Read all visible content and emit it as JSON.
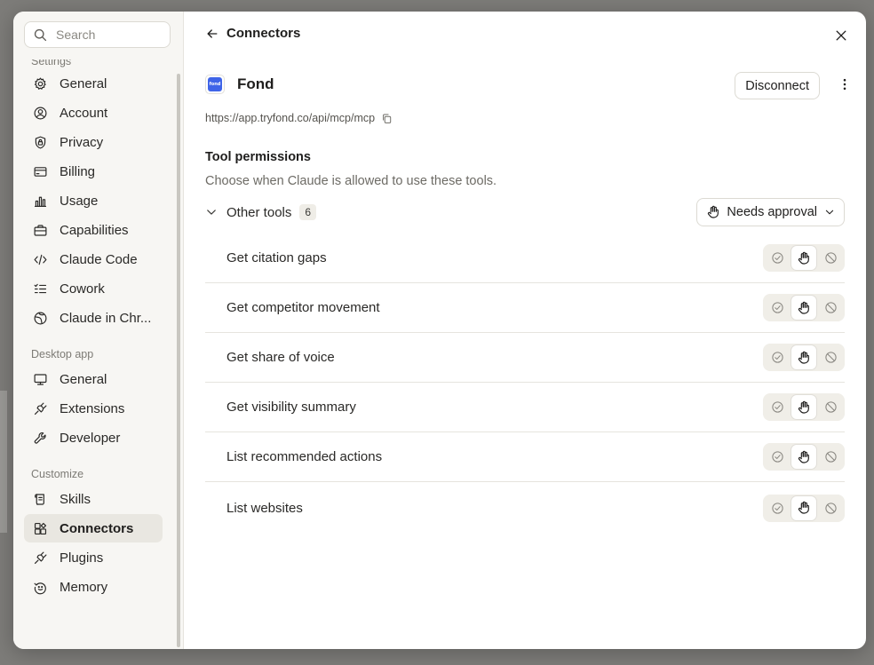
{
  "search": {
    "placeholder": "Search"
  },
  "sidebar": {
    "sections": [
      {
        "label": "Settings",
        "items": [
          {
            "label": "General",
            "icon": "gear-icon"
          },
          {
            "label": "Account",
            "icon": "user-circle-icon"
          },
          {
            "label": "Privacy",
            "icon": "shield-lock-icon"
          },
          {
            "label": "Billing",
            "icon": "credit-card-icon"
          },
          {
            "label": "Usage",
            "icon": "bar-chart-icon"
          },
          {
            "label": "Capabilities",
            "icon": "briefcase-icon"
          },
          {
            "label": "Claude Code",
            "icon": "code-icon"
          },
          {
            "label": "Cowork",
            "icon": "checklist-icon"
          },
          {
            "label": "Claude in Chr...",
            "icon": "globe-icon"
          }
        ]
      },
      {
        "label": "Desktop app",
        "items": [
          {
            "label": "General",
            "icon": "monitor-icon"
          },
          {
            "label": "Extensions",
            "icon": "plug-icon"
          },
          {
            "label": "Developer",
            "icon": "wrench-icon"
          }
        ]
      },
      {
        "label": "Customize",
        "items": [
          {
            "label": "Skills",
            "icon": "scroll-icon"
          },
          {
            "label": "Connectors",
            "icon": "connectors-icon",
            "active": true
          },
          {
            "label": "Plugins",
            "icon": "plug-icon"
          },
          {
            "label": "Memory",
            "icon": "memory-icon"
          }
        ]
      }
    ]
  },
  "header": {
    "title": "Connectors"
  },
  "connector": {
    "name": "Fond",
    "logo_text": "fond",
    "url": "https://app.tryfond.co/api/mcp/mcp",
    "disconnect_label": "Disconnect"
  },
  "permissions": {
    "title": "Tool permissions",
    "description": "Choose when Claude is allowed to use these tools.",
    "group_label": "Other tools",
    "group_count": "6",
    "approval_label": "Needs approval"
  },
  "tools": [
    {
      "name": "Get citation gaps",
      "state": "needs-approval"
    },
    {
      "name": "Get competitor movement",
      "state": "needs-approval"
    },
    {
      "name": "Get share of voice",
      "state": "needs-approval"
    },
    {
      "name": "Get visibility summary",
      "state": "needs-approval"
    },
    {
      "name": "List recommended actions",
      "state": "needs-approval"
    },
    {
      "name": "List websites",
      "state": "needs-approval"
    }
  ],
  "colors": {
    "accent_logo": "#3f64e8",
    "active_nav_bg": "#e9e7e1",
    "sidebar_bg": "#f7f6f3"
  }
}
